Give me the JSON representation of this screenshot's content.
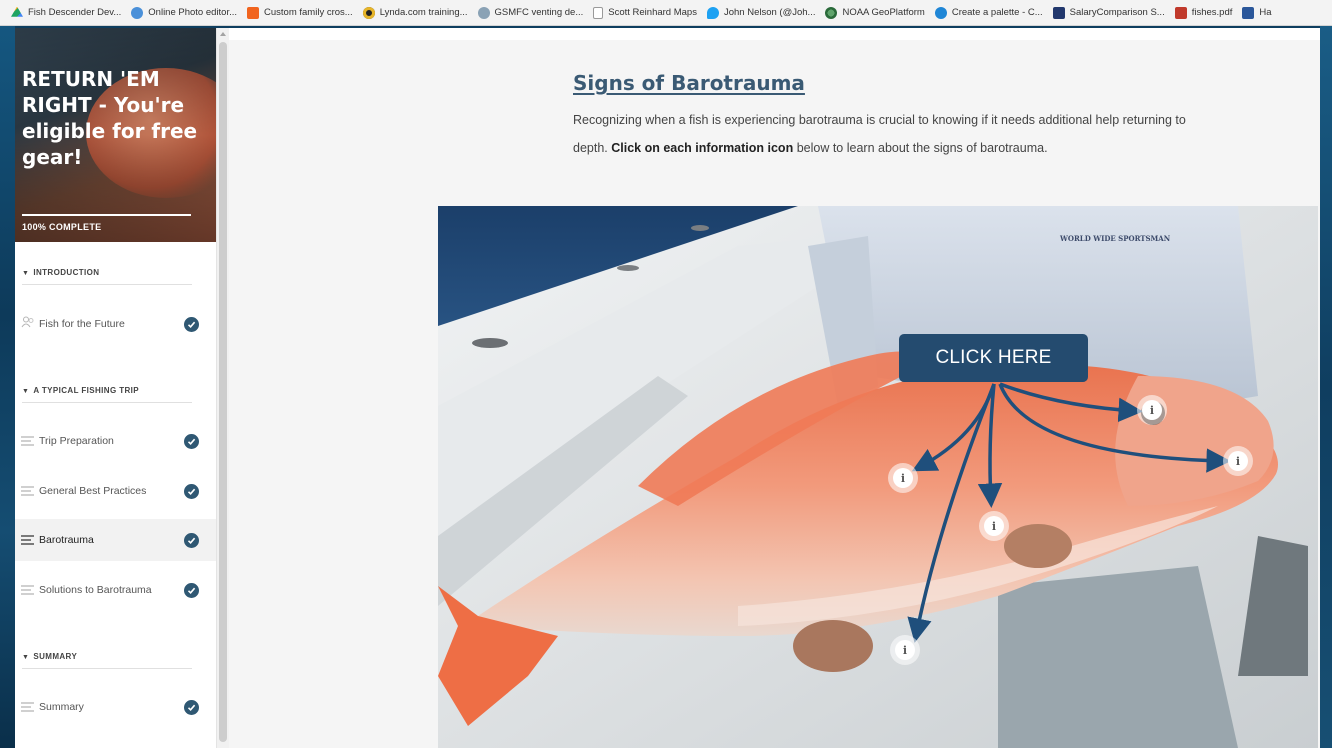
{
  "bookmarks": [
    {
      "label": "Fish Descender Dev...",
      "icon": "drive-icon",
      "color": "#f2b01e"
    },
    {
      "label": "Online Photo editor...",
      "icon": "photo-editor-icon",
      "color": "#4a90d9"
    },
    {
      "label": "Custom family cros...",
      "icon": "etsy-icon",
      "color": "#f1641e"
    },
    {
      "label": "Lynda.com training...",
      "icon": "lynda-icon",
      "color": "#e7b529"
    },
    {
      "label": "GSMFC venting de...",
      "icon": "gsmfc-icon",
      "color": "#8aa2b5"
    },
    {
      "label": "Scott Reinhard Maps",
      "icon": "page-icon",
      "color": "#9a9a9a"
    },
    {
      "label": "John Nelson (@Joh...",
      "icon": "twitter-icon",
      "color": "#1da1f2"
    },
    {
      "label": "NOAA GeoPlatform",
      "icon": "noaa-icon",
      "color": "#2a6a3a"
    },
    {
      "label": "Create a palette - C...",
      "icon": "coolors-icon",
      "color": "#1f86d6"
    },
    {
      "label": "SalaryComparison S...",
      "icon": "salary-icon",
      "color": "#22386d"
    },
    {
      "label": "fishes.pdf",
      "icon": "pdf-icon",
      "color": "#c0392b"
    },
    {
      "label": "Ha",
      "icon": "word-icon",
      "color": "#2b579a"
    }
  ],
  "course": {
    "title": "RETURN 'EM RIGHT - You're eligible for free gear!",
    "progress_text": "100% COMPLETE",
    "progress_fraction": 1.0
  },
  "sidebar": {
    "sections": [
      {
        "title": "INTRODUCTION",
        "lessons": [
          {
            "label": "Fish for the Future",
            "complete": true,
            "icon": "people-icon"
          }
        ]
      },
      {
        "title": "A TYPICAL FISHING TRIP",
        "lessons": [
          {
            "label": "Trip Preparation",
            "complete": true,
            "icon": "text-lines-icon"
          },
          {
            "label": "General Best Practices",
            "complete": true,
            "icon": "text-lines-icon"
          },
          {
            "label": "Barotrauma",
            "complete": true,
            "icon": "text-lines-icon",
            "active": true
          },
          {
            "label": "Solutions to Barotrauma",
            "complete": true,
            "icon": "text-lines-icon"
          }
        ]
      },
      {
        "title": "SUMMARY",
        "lessons": [
          {
            "label": "Summary",
            "complete": true,
            "icon": "text-lines-icon"
          }
        ]
      }
    ]
  },
  "lesson": {
    "title": "Signs of Barotrauma",
    "intro_before": "Recognizing when a fish is experiencing barotrauma is crucial to knowing if it needs additional help returning to depth.  ",
    "intro_bold": "Click on each information icon",
    "intro_after": " below to learn about the signs of barotrauma."
  },
  "image": {
    "callout_label": "CLICK HERE",
    "shirt_logo": "WORLD WIDE SPORTSMAN",
    "hotspot_glyph": "i",
    "hotspot_count": 5
  },
  "colors": {
    "accent": "#2f5873",
    "title": "#3a5a74",
    "callout": "#244b6f",
    "arrow": "#1f4f7c"
  }
}
